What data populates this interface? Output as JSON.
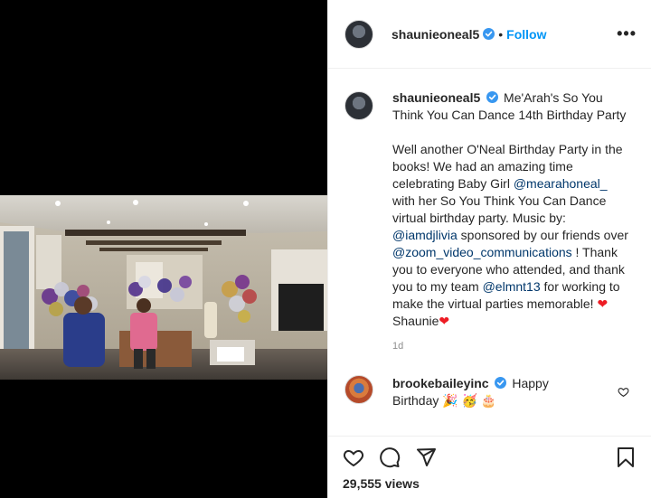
{
  "post": {
    "author": "shaunieoneal5",
    "separator": "•",
    "follow_label": "Follow",
    "more_label": "•••"
  },
  "caption": {
    "username": "shaunieoneal5",
    "title": "Me'Arah's So You Think You Can Dance 14th Birthday Party",
    "p1_a": "Well another O'Neal Birthday Party in the books! We had an amazing time celebrating Baby Girl ",
    "mention1": "@mearahoneal_",
    "p1_b": " with her So You Think You Can Dance virtual birthday party. Music by: ",
    "mention2": "@iamdjlivia",
    "p1_c": " sponsored by our friends over ",
    "mention3": "@zoom_video_communications",
    "p1_d": " ! Thank you to everyone who attended, and thank you to my team ",
    "mention4": "@elmnt13",
    "p1_e": " for working to make the virtual parties memorable! ",
    "heart1": "❤",
    "signoff": "Shaunie",
    "heart2": "❤",
    "time": "1d"
  },
  "comment": {
    "username": "brookebaileyinc",
    "text_a": "Happy",
    "text_b": "Birthday",
    "emoji": "🎉 🥳 🎂"
  },
  "actions": {
    "views_count": "29,555",
    "views_label": "views"
  },
  "colors": {
    "accent": "#0095f6",
    "mention": "#00376b",
    "heart": "#ed1c24"
  }
}
